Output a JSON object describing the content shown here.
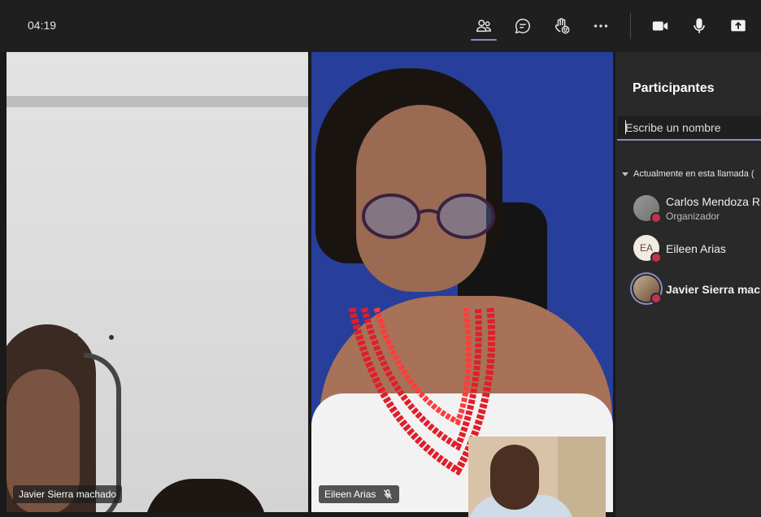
{
  "toolbar": {
    "timer": "04:19",
    "buttons": [
      "people-icon",
      "chat-icon",
      "raise-hand-icon",
      "more-icon",
      "camera-icon",
      "microphone-icon",
      "share-icon"
    ],
    "accent": "#8b8cc7"
  },
  "stage": {
    "tiles": [
      {
        "name": "Javier Sierra machado"
      },
      {
        "name": "Eileen Arias",
        "muted": true
      }
    ]
  },
  "panel": {
    "title": "Participantes",
    "search_placeholder": "Escribe un nombre",
    "section_label": "Actualmente en esta llamada (",
    "participants": [
      {
        "name": "Carlos Mendoza Rio",
        "role": "Organizador",
        "avatar": "photo"
      },
      {
        "name": "Eileen Arias",
        "initials": "EA"
      },
      {
        "name": "Javier Sierra macha",
        "avatar": "photo"
      }
    ],
    "status_color": "#c4314b"
  }
}
